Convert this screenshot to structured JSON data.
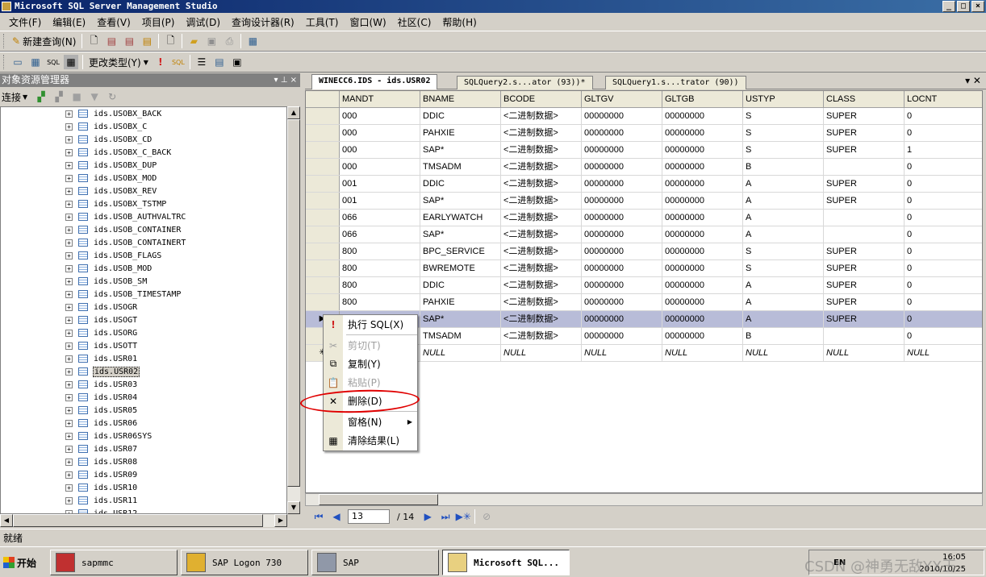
{
  "window": {
    "title": "Microsoft SQL Server Management Studio",
    "controls": [
      "_",
      "□",
      "×"
    ]
  },
  "menu": [
    "文件(F)",
    "编辑(E)",
    "查看(V)",
    "项目(P)",
    "调试(D)",
    "查询设计器(R)",
    "工具(T)",
    "窗口(W)",
    "社区(C)",
    "帮助(H)"
  ],
  "toolbar1": {
    "new_query": "新建查询(N)"
  },
  "toolbar2": {
    "change_type": "更改类型(Y)"
  },
  "object_explorer": {
    "title": "对象资源管理器",
    "connect": "连接",
    "tables": [
      "ids.USOBX_BACK",
      "ids.USOBX_C",
      "ids.USOBX_CD",
      "ids.USOBX_C_BACK",
      "ids.USOBX_DUP",
      "ids.USOBX_MOD",
      "ids.USOBX_REV",
      "ids.USOBX_TSTMP",
      "ids.USOB_AUTHVALTRC",
      "ids.USOB_CONTAINER",
      "ids.USOB_CONTAINERT",
      "ids.USOB_FLAGS",
      "ids.USOB_MOD",
      "ids.USOB_SM",
      "ids.USOB_TIMESTAMP",
      "ids.USOGR",
      "ids.USOGT",
      "ids.USORG",
      "ids.USOTT",
      "ids.USR01",
      "ids.USR02",
      "ids.USR03",
      "ids.USR04",
      "ids.USR05",
      "ids.USR06",
      "ids.USR06SYS",
      "ids.USR07",
      "ids.USR08",
      "ids.USR09",
      "ids.USR10",
      "ids.USR11",
      "ids.USR12"
    ],
    "selected_index": 20
  },
  "tabs": [
    "WINECC6.IDS - ids.USR02",
    "SQLQuery2.s...ator (93))*",
    "SQLQuery1.s...trator (90))"
  ],
  "grid": {
    "columns": [
      "MANDT",
      "BNAME",
      "BCODE",
      "GLTGV",
      "GLTGB",
      "USTYP",
      "CLASS",
      "LOCNT"
    ],
    "rows": [
      [
        "000",
        "DDIC",
        "<二进制数据>",
        "00000000",
        "00000000",
        "S",
        "SUPER",
        "0"
      ],
      [
        "000",
        "PAHXIE",
        "<二进制数据>",
        "00000000",
        "00000000",
        "S",
        "SUPER",
        "0"
      ],
      [
        "000",
        "SAP*",
        "<二进制数据>",
        "00000000",
        "00000000",
        "S",
        "SUPER",
        "1"
      ],
      [
        "000",
        "TMSADM",
        "<二进制数据>",
        "00000000",
        "00000000",
        "B",
        "",
        "0"
      ],
      [
        "001",
        "DDIC",
        "<二进制数据>",
        "00000000",
        "00000000",
        "A",
        "SUPER",
        "0"
      ],
      [
        "001",
        "SAP*",
        "<二进制数据>",
        "00000000",
        "00000000",
        "A",
        "SUPER",
        "0"
      ],
      [
        "066",
        "EARLYWATCH",
        "<二进制数据>",
        "00000000",
        "00000000",
        "A",
        "",
        "0"
      ],
      [
        "066",
        "SAP*",
        "<二进制数据>",
        "00000000",
        "00000000",
        "A",
        "",
        "0"
      ],
      [
        "800",
        "BPC_SERVICE",
        "<二进制数据>",
        "00000000",
        "00000000",
        "S",
        "SUPER",
        "0"
      ],
      [
        "800",
        "BWREMOTE",
        "<二进制数据>",
        "00000000",
        "00000000",
        "S",
        "SUPER",
        "0"
      ],
      [
        "800",
        "DDIC",
        "<二进制数据>",
        "00000000",
        "00000000",
        "A",
        "SUPER",
        "0"
      ],
      [
        "800",
        "PAHXIE",
        "<二进制数据>",
        "00000000",
        "00000000",
        "A",
        "SUPER",
        "0"
      ],
      [
        "",
        "SAP*",
        "<二进制数据>",
        "00000000",
        "00000000",
        "A",
        "SUPER",
        "0"
      ],
      [
        "",
        "TMSADM",
        "<二进制数据>",
        "00000000",
        "00000000",
        "B",
        "",
        "0"
      ],
      [
        "",
        "NULL",
        "NULL",
        "NULL",
        "NULL",
        "NULL",
        "NULL",
        "NULL"
      ]
    ],
    "highlighted_row": 12,
    "row_markers": {
      "12": "▶",
      "14": "✳"
    }
  },
  "navigation": {
    "current": "13",
    "total": "/ 14"
  },
  "context_menu": [
    {
      "icon": "!",
      "label": "执行 SQL(X)",
      "disabled": false
    },
    {
      "sep": true
    },
    {
      "icon": "✂",
      "label": "剪切(T)",
      "disabled": true
    },
    {
      "icon": "⧉",
      "label": "复制(Y)",
      "disabled": false
    },
    {
      "icon": "📋",
      "label": "粘贴(P)",
      "disabled": true
    },
    {
      "icon": "✕",
      "label": "删除(D)",
      "disabled": false
    },
    {
      "sep": true
    },
    {
      "icon": "",
      "label": "窗格(N)",
      "disabled": false,
      "submenu": true
    },
    {
      "icon": "▦",
      "label": "清除结果(L)",
      "disabled": false
    }
  ],
  "status": {
    "text": "就绪"
  },
  "taskbar": {
    "start": "开始",
    "tasks": [
      "sapmmc",
      "SAP Logon 730",
      "SAP",
      "Microsoft SQL..."
    ],
    "active_task": 3,
    "tray": {
      "lang": "EN",
      "time": "16:05",
      "date": "2010/10/25",
      "watermark": "CSDN @神勇无敌YX王"
    }
  },
  "colors": {
    "highlight_row": "#b8bcd8",
    "title_bar": "#0a246a",
    "annotation_circle": "#e00000"
  }
}
